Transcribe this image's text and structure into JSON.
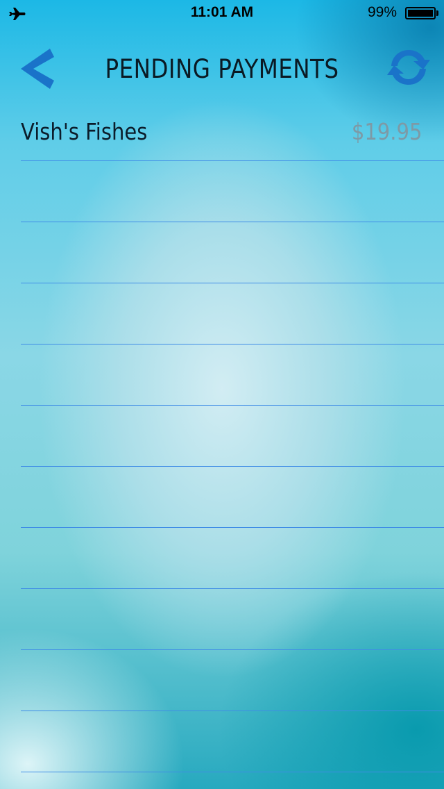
{
  "status_bar": {
    "time": "11:01 AM",
    "battery_percent": "99%",
    "battery_level": 0.99,
    "icons": [
      "airplane-icon",
      "battery-icon"
    ]
  },
  "nav": {
    "title": "PENDING PAYMENTS",
    "back_icon": "chevron-left-icon",
    "refresh_icon": "refresh-icon",
    "accent_color": "#1a73c9"
  },
  "payments": [
    {
      "name": "Vish's Fishes",
      "amount": "$19.95"
    }
  ],
  "colors": {
    "separator": "#3f8ce6",
    "amount_text": "#7d9aa6",
    "primary_text": "#0b1c2a"
  }
}
